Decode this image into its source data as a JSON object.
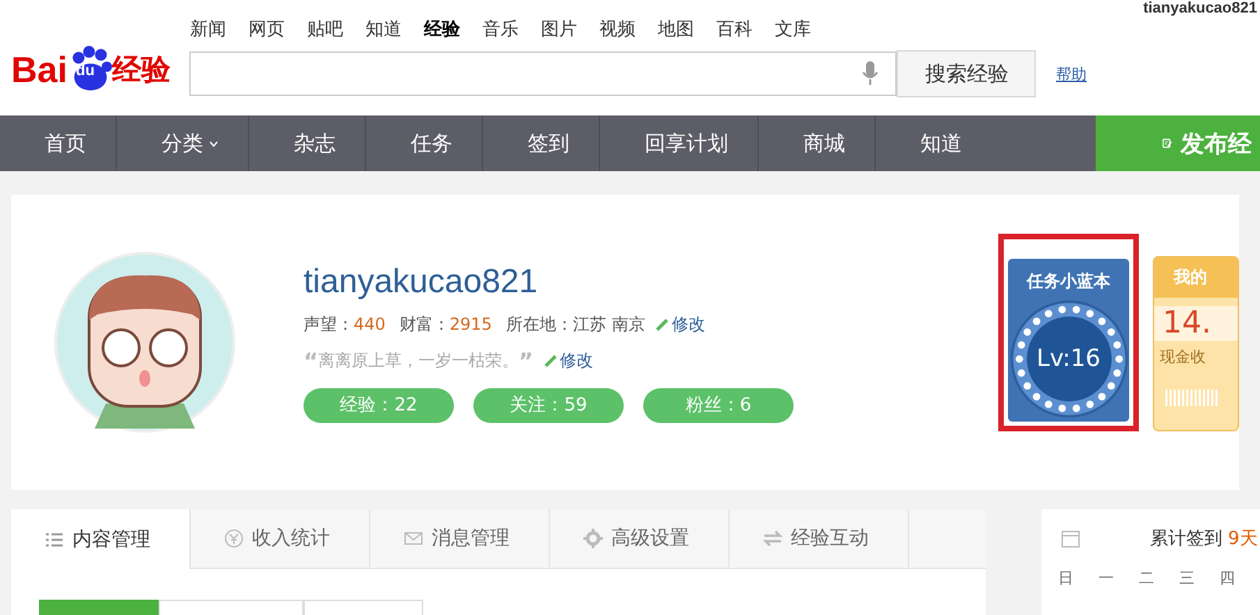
{
  "header": {
    "username": "tianyakucao821",
    "logo": {
      "brand": "Bai",
      "du": "du",
      "product": "经验"
    },
    "nav_links": [
      {
        "label": "新闻",
        "selected": false
      },
      {
        "label": "网页",
        "selected": false
      },
      {
        "label": "贴吧",
        "selected": false
      },
      {
        "label": "知道",
        "selected": false
      },
      {
        "label": "经验",
        "selected": true
      },
      {
        "label": "音乐",
        "selected": false
      },
      {
        "label": "图片",
        "selected": false
      },
      {
        "label": "视频",
        "selected": false
      },
      {
        "label": "地图",
        "selected": false
      },
      {
        "label": "百科",
        "selected": false
      },
      {
        "label": "文库",
        "selected": false
      }
    ],
    "search_button": "搜索经验",
    "help_link": "帮助"
  },
  "main_nav": {
    "items": [
      {
        "label": "首页",
        "dropdown": false
      },
      {
        "label": "分类",
        "dropdown": true
      },
      {
        "label": "杂志",
        "dropdown": false
      },
      {
        "label": "任务",
        "dropdown": false
      },
      {
        "label": "签到",
        "dropdown": false
      },
      {
        "label": "回享计划",
        "dropdown": false
      },
      {
        "label": "商城",
        "dropdown": false
      },
      {
        "label": "知道",
        "dropdown": false
      }
    ],
    "publish_button": "发布经"
  },
  "profile": {
    "name": "tianyakucao821",
    "reputation_label": "声望：",
    "reputation": "440",
    "wealth_label": "财富：",
    "wealth": "2915",
    "location_label": "所在地：",
    "location": "江苏 南京",
    "edit_link": "修改",
    "open_quote": "“",
    "motto": "离离原上草，一岁一枯荣。",
    "close_quote": "”",
    "motto_edit_link": "修改",
    "stats": [
      "经验：22",
      "关注：59",
      "粉丝：6"
    ]
  },
  "task_card": {
    "title": "任务小蓝本",
    "level": "Lv:16",
    "highlighted": true
  },
  "income_card": {
    "title": "我的",
    "amount": "14.",
    "caption": "现金收"
  },
  "tabs": [
    {
      "label": "内容管理",
      "selected": true
    },
    {
      "label": "收入统计",
      "selected": false
    },
    {
      "label": "消息管理",
      "selected": false
    },
    {
      "label": "高级设置",
      "selected": false
    },
    {
      "label": "经验互动",
      "selected": false
    }
  ],
  "sub_tabs": [
    {
      "selected": true
    },
    {
      "selected": false
    },
    {
      "selected": false
    }
  ],
  "checkin": {
    "label": "累计签到",
    "days": "9天",
    "weekdays": [
      "日",
      "一",
      "二",
      "三",
      "四"
    ]
  }
}
